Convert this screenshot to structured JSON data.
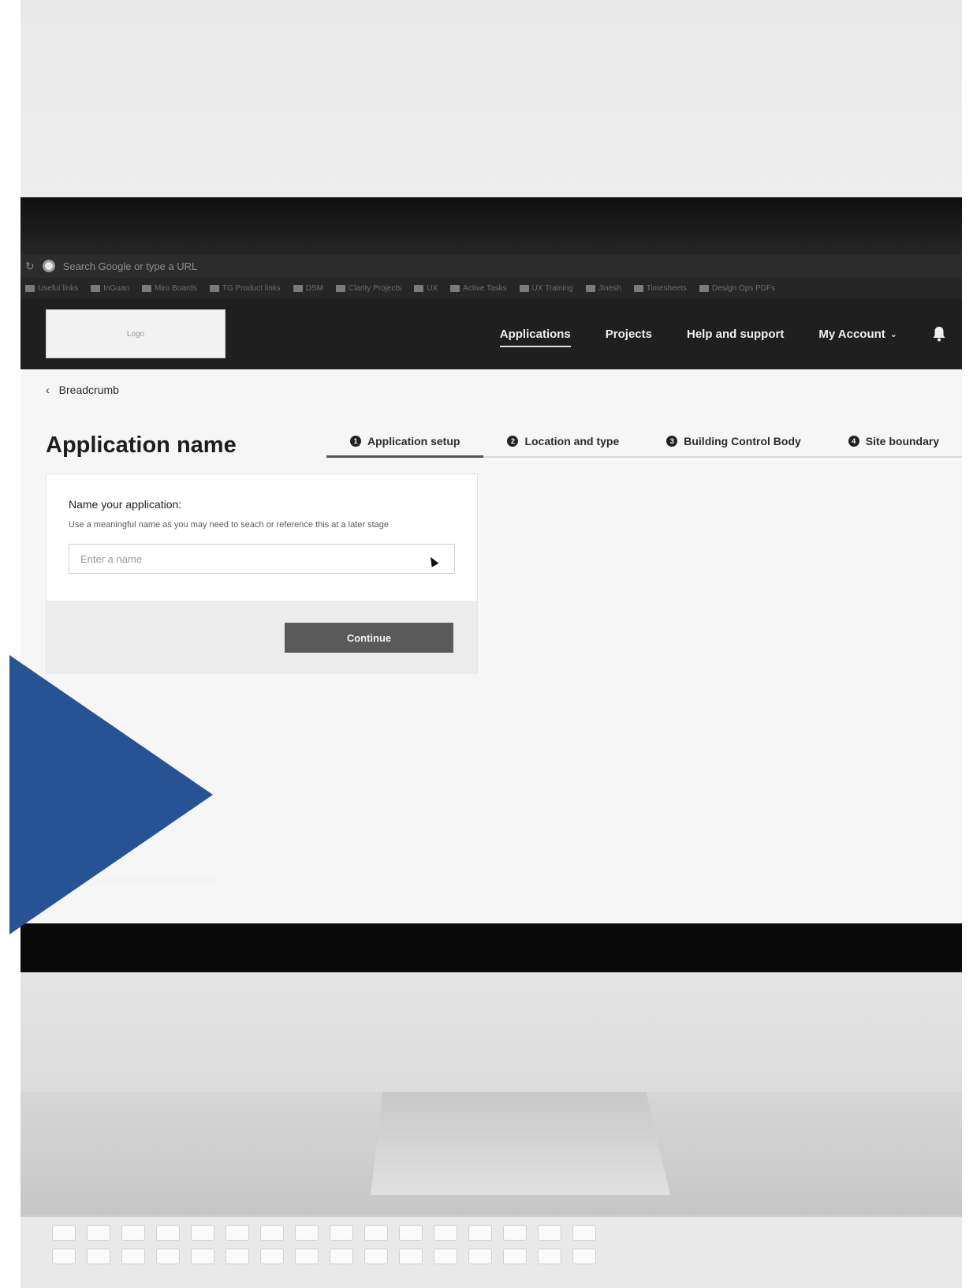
{
  "browser": {
    "url_placeholder": "Search Google or type a URL",
    "bookmarks": [
      "Useful links",
      "InGuan",
      "Miro Boards",
      "TG Product links",
      "DSM",
      "Clarity Projects",
      "UX",
      "Active Tasks",
      "UX Training",
      "Jinesh",
      "Timesheets",
      "Design Ops PDFs"
    ]
  },
  "header": {
    "logo_text": "Logo",
    "nav": {
      "applications": "Applications",
      "projects": "Projects",
      "help": "Help and support",
      "account": "My Account"
    }
  },
  "breadcrumb": "Breadcrumb",
  "page_title": "Application name",
  "steps": [
    {
      "num": "1",
      "label": "Application setup"
    },
    {
      "num": "2",
      "label": "Location and type"
    },
    {
      "num": "3",
      "label": "Building Control Body"
    },
    {
      "num": "4",
      "label": "Site boundary"
    }
  ],
  "form": {
    "label": "Name your application:",
    "hint": "Use a meaningful name as you may need to seach or reference this at a later stage",
    "input_placeholder": "Enter a name",
    "input_value": "",
    "continue_label": "Continue"
  },
  "colors": {
    "play_accent": "#275394",
    "header_bg": "#1f1f1f"
  }
}
